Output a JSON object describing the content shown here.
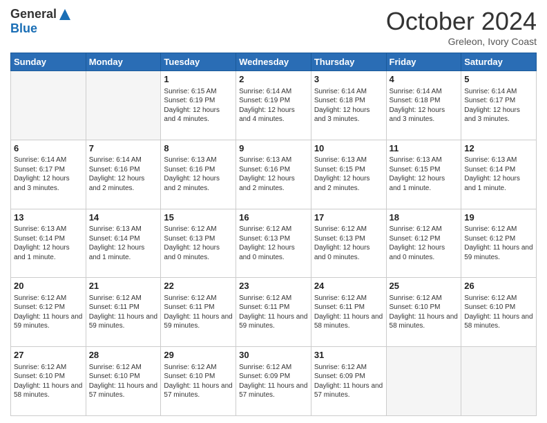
{
  "logo": {
    "general": "General",
    "blue": "Blue"
  },
  "title": "October 2024",
  "location": "Greleon, Ivory Coast",
  "days_of_week": [
    "Sunday",
    "Monday",
    "Tuesday",
    "Wednesday",
    "Thursday",
    "Friday",
    "Saturday"
  ],
  "weeks": [
    [
      {
        "day": "",
        "info": ""
      },
      {
        "day": "",
        "info": ""
      },
      {
        "day": "1",
        "info": "Sunrise: 6:15 AM\nSunset: 6:19 PM\nDaylight: 12 hours and 4 minutes."
      },
      {
        "day": "2",
        "info": "Sunrise: 6:14 AM\nSunset: 6:19 PM\nDaylight: 12 hours and 4 minutes."
      },
      {
        "day": "3",
        "info": "Sunrise: 6:14 AM\nSunset: 6:18 PM\nDaylight: 12 hours and 3 minutes."
      },
      {
        "day": "4",
        "info": "Sunrise: 6:14 AM\nSunset: 6:18 PM\nDaylight: 12 hours and 3 minutes."
      },
      {
        "day": "5",
        "info": "Sunrise: 6:14 AM\nSunset: 6:17 PM\nDaylight: 12 hours and 3 minutes."
      }
    ],
    [
      {
        "day": "6",
        "info": "Sunrise: 6:14 AM\nSunset: 6:17 PM\nDaylight: 12 hours and 3 minutes."
      },
      {
        "day": "7",
        "info": "Sunrise: 6:14 AM\nSunset: 6:16 PM\nDaylight: 12 hours and 2 minutes."
      },
      {
        "day": "8",
        "info": "Sunrise: 6:13 AM\nSunset: 6:16 PM\nDaylight: 12 hours and 2 minutes."
      },
      {
        "day": "9",
        "info": "Sunrise: 6:13 AM\nSunset: 6:16 PM\nDaylight: 12 hours and 2 minutes."
      },
      {
        "day": "10",
        "info": "Sunrise: 6:13 AM\nSunset: 6:15 PM\nDaylight: 12 hours and 2 minutes."
      },
      {
        "day": "11",
        "info": "Sunrise: 6:13 AM\nSunset: 6:15 PM\nDaylight: 12 hours and 1 minute."
      },
      {
        "day": "12",
        "info": "Sunrise: 6:13 AM\nSunset: 6:14 PM\nDaylight: 12 hours and 1 minute."
      }
    ],
    [
      {
        "day": "13",
        "info": "Sunrise: 6:13 AM\nSunset: 6:14 PM\nDaylight: 12 hours and 1 minute."
      },
      {
        "day": "14",
        "info": "Sunrise: 6:13 AM\nSunset: 6:14 PM\nDaylight: 12 hours and 1 minute."
      },
      {
        "day": "15",
        "info": "Sunrise: 6:12 AM\nSunset: 6:13 PM\nDaylight: 12 hours and 0 minutes."
      },
      {
        "day": "16",
        "info": "Sunrise: 6:12 AM\nSunset: 6:13 PM\nDaylight: 12 hours and 0 minutes."
      },
      {
        "day": "17",
        "info": "Sunrise: 6:12 AM\nSunset: 6:13 PM\nDaylight: 12 hours and 0 minutes."
      },
      {
        "day": "18",
        "info": "Sunrise: 6:12 AM\nSunset: 6:12 PM\nDaylight: 12 hours and 0 minutes."
      },
      {
        "day": "19",
        "info": "Sunrise: 6:12 AM\nSunset: 6:12 PM\nDaylight: 11 hours and 59 minutes."
      }
    ],
    [
      {
        "day": "20",
        "info": "Sunrise: 6:12 AM\nSunset: 6:12 PM\nDaylight: 11 hours and 59 minutes."
      },
      {
        "day": "21",
        "info": "Sunrise: 6:12 AM\nSunset: 6:11 PM\nDaylight: 11 hours and 59 minutes."
      },
      {
        "day": "22",
        "info": "Sunrise: 6:12 AM\nSunset: 6:11 PM\nDaylight: 11 hours and 59 minutes."
      },
      {
        "day": "23",
        "info": "Sunrise: 6:12 AM\nSunset: 6:11 PM\nDaylight: 11 hours and 59 minutes."
      },
      {
        "day": "24",
        "info": "Sunrise: 6:12 AM\nSunset: 6:11 PM\nDaylight: 11 hours and 58 minutes."
      },
      {
        "day": "25",
        "info": "Sunrise: 6:12 AM\nSunset: 6:10 PM\nDaylight: 11 hours and 58 minutes."
      },
      {
        "day": "26",
        "info": "Sunrise: 6:12 AM\nSunset: 6:10 PM\nDaylight: 11 hours and 58 minutes."
      }
    ],
    [
      {
        "day": "27",
        "info": "Sunrise: 6:12 AM\nSunset: 6:10 PM\nDaylight: 11 hours and 58 minutes."
      },
      {
        "day": "28",
        "info": "Sunrise: 6:12 AM\nSunset: 6:10 PM\nDaylight: 11 hours and 57 minutes."
      },
      {
        "day": "29",
        "info": "Sunrise: 6:12 AM\nSunset: 6:10 PM\nDaylight: 11 hours and 57 minutes."
      },
      {
        "day": "30",
        "info": "Sunrise: 6:12 AM\nSunset: 6:09 PM\nDaylight: 11 hours and 57 minutes."
      },
      {
        "day": "31",
        "info": "Sunrise: 6:12 AM\nSunset: 6:09 PM\nDaylight: 11 hours and 57 minutes."
      },
      {
        "day": "",
        "info": ""
      },
      {
        "day": "",
        "info": ""
      }
    ]
  ]
}
